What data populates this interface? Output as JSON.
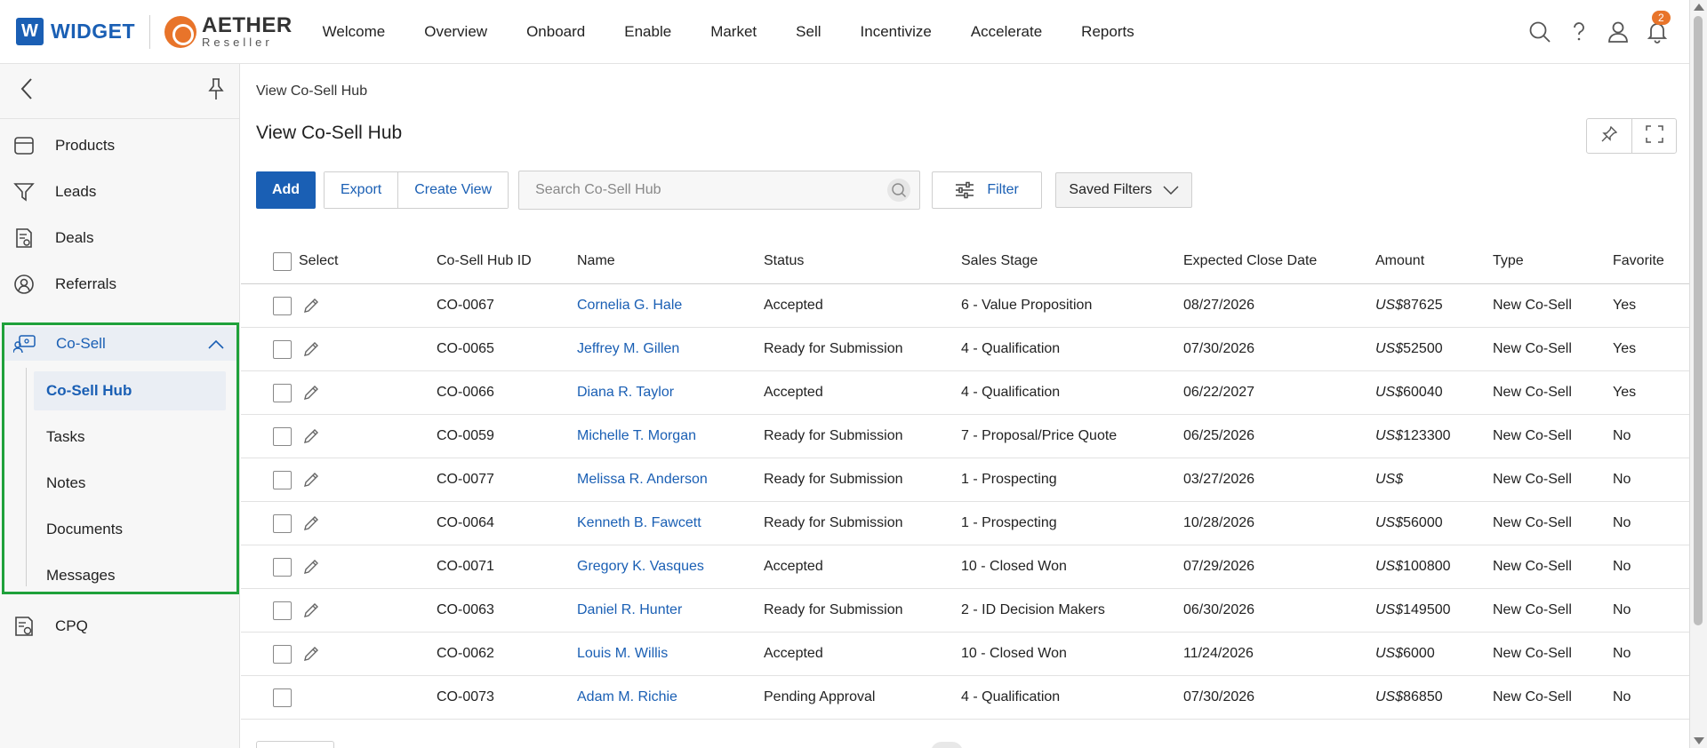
{
  "brand": {
    "widget_letter": "W",
    "widget_name": "WIDGET",
    "aether_name": "AETHER",
    "aether_sub": "Reseller"
  },
  "topnav": [
    "Welcome",
    "Overview",
    "Onboard",
    "Enable",
    "Market",
    "Sell",
    "Incentivize",
    "Accelerate",
    "Reports"
  ],
  "notifications_count": "2",
  "sidebar": {
    "items_top": [
      {
        "label": "Products",
        "icon": "box-icon"
      },
      {
        "label": "Leads",
        "icon": "funnel-icon"
      },
      {
        "label": "Deals",
        "icon": "document-dollar-icon"
      },
      {
        "label": "Referrals",
        "icon": "person-circle-icon"
      }
    ],
    "cosell": {
      "label": "Co-Sell",
      "subitems": [
        "Co-Sell Hub",
        "Tasks",
        "Notes",
        "Documents",
        "Messages"
      ]
    },
    "items_bottom": [
      {
        "label": "CPQ",
        "icon": "calculator-icon"
      }
    ]
  },
  "breadcrumb": "View Co-Sell Hub",
  "page_title": "View Co-Sell Hub",
  "toolbar": {
    "add": "Add",
    "export": "Export",
    "create_view": "Create View",
    "search_placeholder": "Search Co-Sell Hub",
    "filter": "Filter",
    "saved_filters": "Saved Filters"
  },
  "table": {
    "headers": [
      "Select",
      "Co-Sell Hub ID",
      "Name",
      "Status",
      "Sales Stage",
      "Expected Close Date",
      "Amount",
      "Type",
      "Favorite"
    ],
    "currency_prefix": "US$",
    "rows": [
      {
        "id": "CO-0067",
        "name": "Cornelia G. Hale",
        "status": "Accepted",
        "stage": "6 - Value Proposition",
        "close": "08/27/2026",
        "amount": "87625",
        "type": "New Co-Sell",
        "fav": "Yes",
        "editable": true
      },
      {
        "id": "CO-0065",
        "name": "Jeffrey M. Gillen",
        "status": "Ready for Submission",
        "stage": "4 - Qualification",
        "close": "07/30/2026",
        "amount": "52500",
        "type": "New Co-Sell",
        "fav": "Yes",
        "editable": true
      },
      {
        "id": "CO-0066",
        "name": "Diana R. Taylor",
        "status": "Accepted",
        "stage": "4 - Qualification",
        "close": "06/22/2027",
        "amount": "60040",
        "type": "New Co-Sell",
        "fav": "Yes",
        "editable": true
      },
      {
        "id": "CO-0059",
        "name": "Michelle T. Morgan",
        "status": "Ready for Submission",
        "stage": "7 - Proposal/Price Quote",
        "close": "06/25/2026",
        "amount": "123300",
        "type": "New Co-Sell",
        "fav": "No",
        "editable": true
      },
      {
        "id": "CO-0077",
        "name": "Melissa R. Anderson",
        "status": "Ready for Submission",
        "stage": "1 - Prospecting",
        "close": "03/27/2026",
        "amount": "",
        "type": "New Co-Sell",
        "fav": "No",
        "editable": true
      },
      {
        "id": "CO-0064",
        "name": "Kenneth B. Fawcett",
        "status": "Ready for Submission",
        "stage": "1 - Prospecting",
        "close": "10/28/2026",
        "amount": "56000",
        "type": "New Co-Sell",
        "fav": "No",
        "editable": true
      },
      {
        "id": "CO-0071",
        "name": "Gregory K. Vasques",
        "status": "Accepted",
        "stage": "10 - Closed Won",
        "close": "07/29/2026",
        "amount": "100800",
        "type": "New Co-Sell",
        "fav": "No",
        "editable": true
      },
      {
        "id": "CO-0063",
        "name": "Daniel R. Hunter",
        "status": "Ready for Submission",
        "stage": "2 - ID Decision Makers",
        "close": "06/30/2026",
        "amount": "149500",
        "type": "New Co-Sell",
        "fav": "No",
        "editable": true
      },
      {
        "id": "CO-0062",
        "name": "Louis M. Willis",
        "status": "Accepted",
        "stage": "10 - Closed Won",
        "close": "11/24/2026",
        "amount": "6000",
        "type": "New Co-Sell",
        "fav": "No",
        "editable": true
      },
      {
        "id": "CO-0073",
        "name": "Adam M. Richie",
        "status": "Pending Approval",
        "stage": "4 - Qualification",
        "close": "07/30/2026",
        "amount": "86850",
        "type": "New Co-Sell",
        "fav": "No",
        "editable": false
      }
    ]
  },
  "colors": {
    "primary": "#1a5fb4",
    "accent": "#e8742a",
    "highlight_border": "#1fa13b"
  }
}
